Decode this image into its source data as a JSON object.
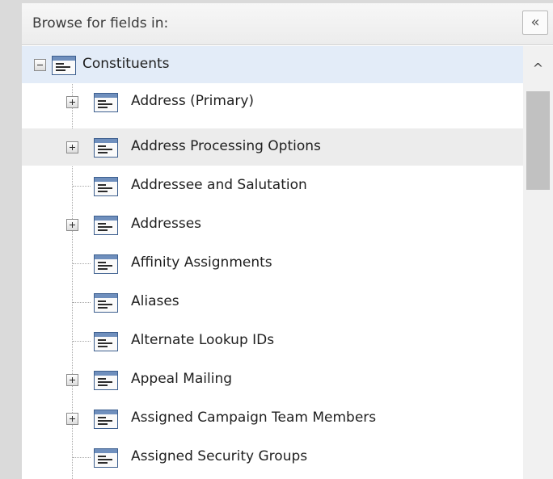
{
  "header": {
    "title": "Browse for fields in:",
    "collapse_icon": "double-chevron-left-icon",
    "collapse_glyph": "«"
  },
  "tree": {
    "root": {
      "label": "Constituents",
      "expanded": true,
      "selected": true
    },
    "children": [
      {
        "label": "Address (Primary)",
        "expandable": true
      },
      {
        "label": "Address Processing Options",
        "expandable": true,
        "hovered": true
      },
      {
        "label": "Addressee and Salutation",
        "expandable": false
      },
      {
        "label": "Addresses",
        "expandable": true
      },
      {
        "label": "Affinity Assignments",
        "expandable": false
      },
      {
        "label": "Aliases",
        "expandable": false
      },
      {
        "label": "Alternate Lookup IDs",
        "expandable": false
      },
      {
        "label": "Appeal Mailing",
        "expandable": true
      },
      {
        "label": "Assigned Campaign Team Members",
        "expandable": true
      },
      {
        "label": "Assigned Security Groups",
        "expandable": false
      }
    ]
  },
  "scrollbar": {
    "up_glyph": "^",
    "up_icon": "chevron-up-icon"
  },
  "colors": {
    "selected_row": "#e3ecf8",
    "hover_row": "#ececec",
    "icon_border": "#3d5f8f",
    "icon_header": "#6f8fbd"
  }
}
